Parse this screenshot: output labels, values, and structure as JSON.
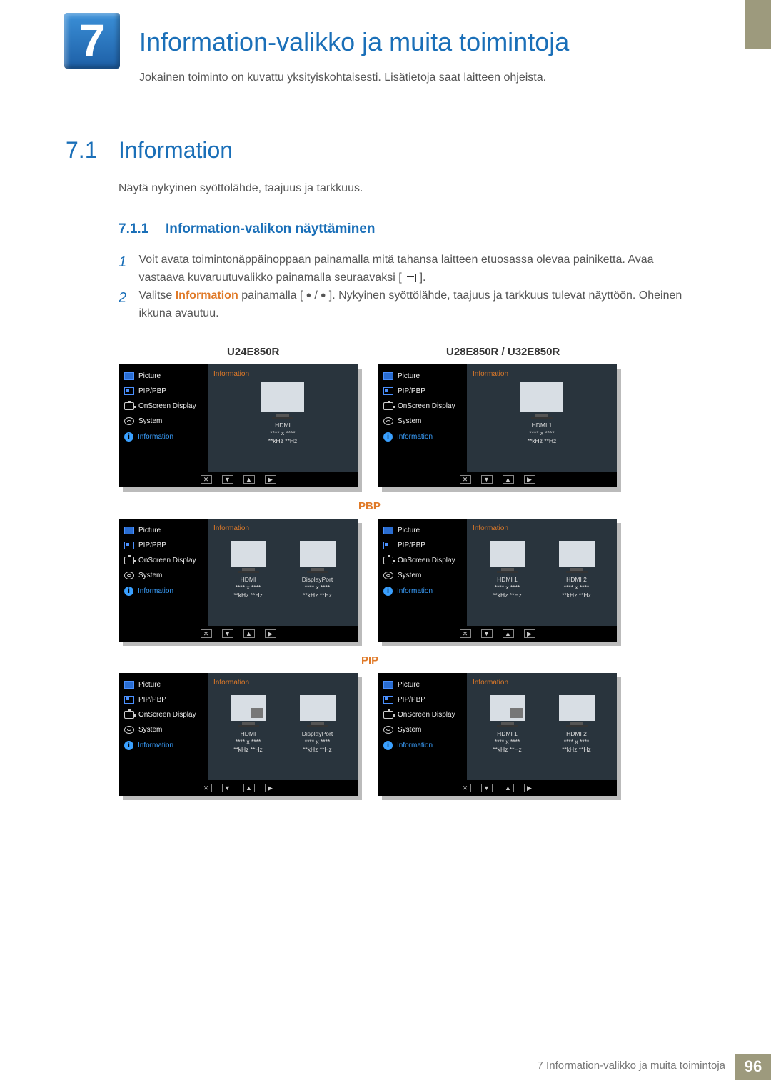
{
  "chapter": {
    "number": "7",
    "title": "Information-valikko ja muita toimintoja",
    "intro": "Jokainen toiminto on kuvattu yksityiskohtaisesti. Lisätietoja saat laitteen ohjeista."
  },
  "section": {
    "number": "7.1",
    "title": "Information",
    "text": "Näytä nykyinen syöttölähde, taajuus ja tarkkuus."
  },
  "subsection": {
    "number": "7.1.1",
    "title": "Information-valikon näyttäminen"
  },
  "steps": {
    "s1": {
      "num": "1",
      "text_a": "Voit avata toimintonäppäinoppaan painamalla mitä tahansa laitteen etuosassa olevaa painiketta. Avaa vastaava kuvaruutuvalikko painamalla seuraavaksi [",
      "text_b": "]."
    },
    "s2": {
      "num": "2",
      "text_a": "Valitse ",
      "highlight": "Information",
      "text_b": " painamalla [",
      "text_c": "]. Nykyinen syöttölähde, taajuus ja tarkkuus tulevat näyttöön. Oheinen ikkuna avautuu."
    }
  },
  "models": {
    "left": "U24E850R",
    "right": "U28E850R / U32E850R"
  },
  "pbp_label": "PBP",
  "pip_label": "PIP",
  "osd_menu": {
    "picture": "Picture",
    "pippbp": "PIP/PBP",
    "onscreen": "OnScreen Display",
    "system": "System",
    "information": "Information",
    "panel_title": "Information"
  },
  "signals": {
    "hdmi": "HDMI",
    "hdmi1": "HDMI 1",
    "hdmi2": "HDMI 2",
    "dp": "DisplayPort",
    "res": "**** x ****",
    "freq": "**kHz **Hz"
  },
  "nav": {
    "close": "✕",
    "down": "▼",
    "up": "▲",
    "right": "▶"
  },
  "footer": {
    "text": "7 Information-valikko ja muita toimintoja",
    "page": "96"
  }
}
